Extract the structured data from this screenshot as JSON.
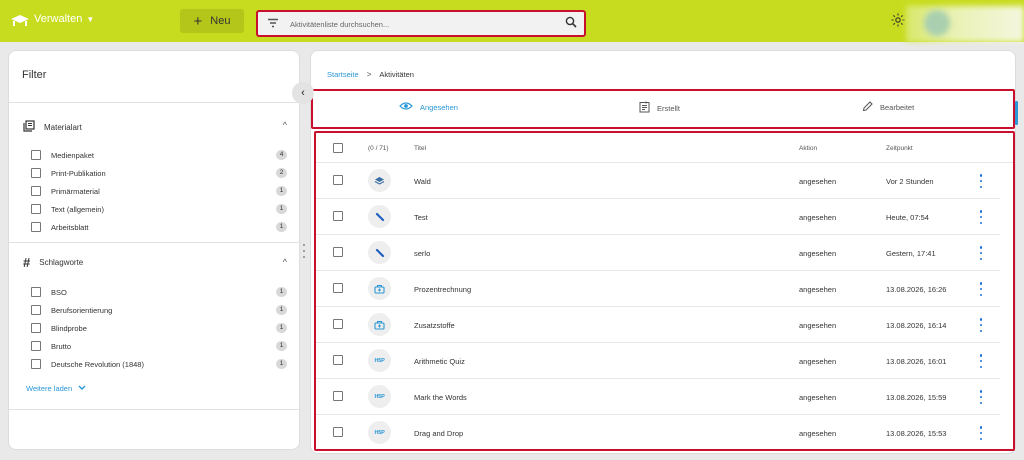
{
  "header": {
    "manage_label": "Verwalten",
    "new_label": "Neu",
    "search_placeholder": "Aktivitätenliste durchsuchen..."
  },
  "filter": {
    "title": "Filter",
    "sections": [
      {
        "title": "Materialart",
        "icon": "library-icon",
        "items": [
          {
            "label": "Medienpaket",
            "count": "4"
          },
          {
            "label": "Print-Publikation",
            "count": "2"
          },
          {
            "label": "Primärmaterial",
            "count": "1"
          },
          {
            "label": "Text (allgemein)",
            "count": "1"
          },
          {
            "label": "Arbeitsblatt",
            "count": "1"
          }
        ]
      },
      {
        "title": "Schlagworte",
        "icon": "hashtag-icon",
        "items": [
          {
            "label": "BSO",
            "count": "1"
          },
          {
            "label": "Berufsorientierung",
            "count": "1"
          },
          {
            "label": "Blindprobe",
            "count": "1"
          },
          {
            "label": "Brutto",
            "count": "1"
          },
          {
            "label": "Deutsche Revolution (1848)",
            "count": "1"
          }
        ]
      }
    ],
    "load_more": "Weitere laden"
  },
  "breadcrumb": {
    "home": "Startseite",
    "separator": ">",
    "current": "Aktivitäten"
  },
  "tabs": [
    {
      "label": "Angesehen",
      "icon": "eye-icon",
      "active": true
    },
    {
      "label": "Erstellt",
      "icon": "document-icon",
      "active": false
    },
    {
      "label": "Bearbeitet",
      "icon": "pencil-icon",
      "active": false
    }
  ],
  "table": {
    "count_label": "(0 / 71)",
    "columns": {
      "title": "Titel",
      "action": "Aktion",
      "time": "Zeitpunkt"
    },
    "rows": [
      {
        "title": "Wald",
        "action": "angesehen",
        "time": "Vor 2 Stunden",
        "icon": "layers-icon"
      },
      {
        "title": "Test",
        "action": "angesehen",
        "time": "Heute, 07:54",
        "icon": "pen-icon"
      },
      {
        "title": "serlo",
        "action": "angesehen",
        "time": "Gestern, 17:41",
        "icon": "pen-icon"
      },
      {
        "title": "Prozentrechnung",
        "action": "angesehen",
        "time": "13.08.2026, 16:26",
        "icon": "bag-icon"
      },
      {
        "title": "Zusatzstoffe",
        "action": "angesehen",
        "time": "13.08.2026, 16:14",
        "icon": "bag-icon"
      },
      {
        "title": "Arithmetic Quiz",
        "action": "angesehen",
        "time": "13.08.2026, 16:01",
        "icon": "h5p-icon",
        "icon_text": "H5P"
      },
      {
        "title": "Mark the Words",
        "action": "angesehen",
        "time": "13.08.2026, 15:59",
        "icon": "h5p-icon",
        "icon_text": "H5P"
      },
      {
        "title": "Drag and Drop",
        "action": "angesehen",
        "time": "13.08.2026, 15:53",
        "icon": "h5p-icon",
        "icon_text": "H5P"
      }
    ]
  },
  "colors": {
    "topbar": "#c8dc1f",
    "accent_blue": "#2a97d6",
    "highlight_red": "#c8102e"
  }
}
